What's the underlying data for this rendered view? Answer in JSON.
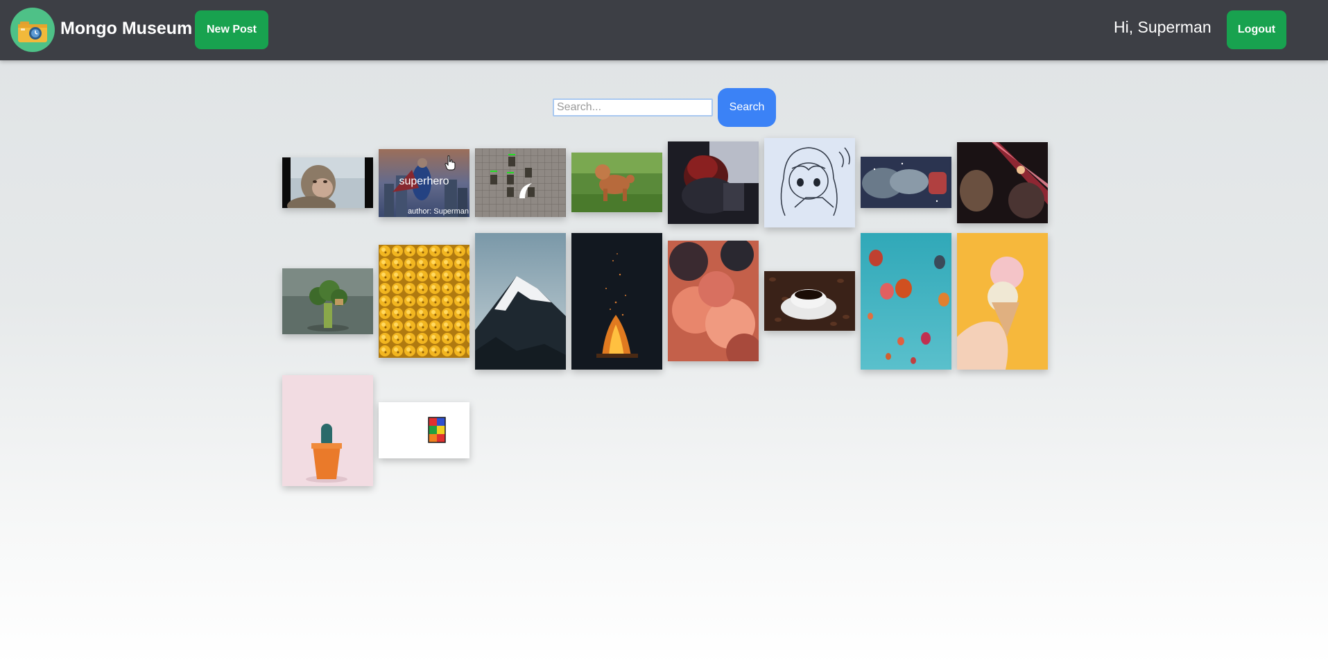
{
  "app": {
    "title": "Mongo Museum",
    "logo_icon": "camera-clock-icon"
  },
  "nav": {
    "new_post_label": "New Post",
    "greeting": "Hi, Superman",
    "logout_label": "Logout"
  },
  "search": {
    "placeholder": "Search...",
    "value": "",
    "button_label": "Search"
  },
  "gallery": {
    "hovered_post": {
      "title": "superhero",
      "author": "author: Superman"
    },
    "images": [
      "monkey",
      "superhero",
      "pixel-game-sprites",
      "brown-poodle",
      "dark-warrior-art",
      "anime-sketch",
      "fantasy-fist",
      "fire-warrior-art",
      "broccoli-treehouse",
      "yellow-beads",
      "snowy-mountain",
      "campfire",
      "pink-clouds",
      "coffee-cup",
      "hot-air-balloons",
      "ice-cream-cone",
      "potted-cactus",
      "rubiks-cube"
    ]
  },
  "colors": {
    "navbar": "#3d3f45",
    "green_button": "#18a24f",
    "search_button": "#3b82f6",
    "logo_circle": "#4ec187"
  }
}
